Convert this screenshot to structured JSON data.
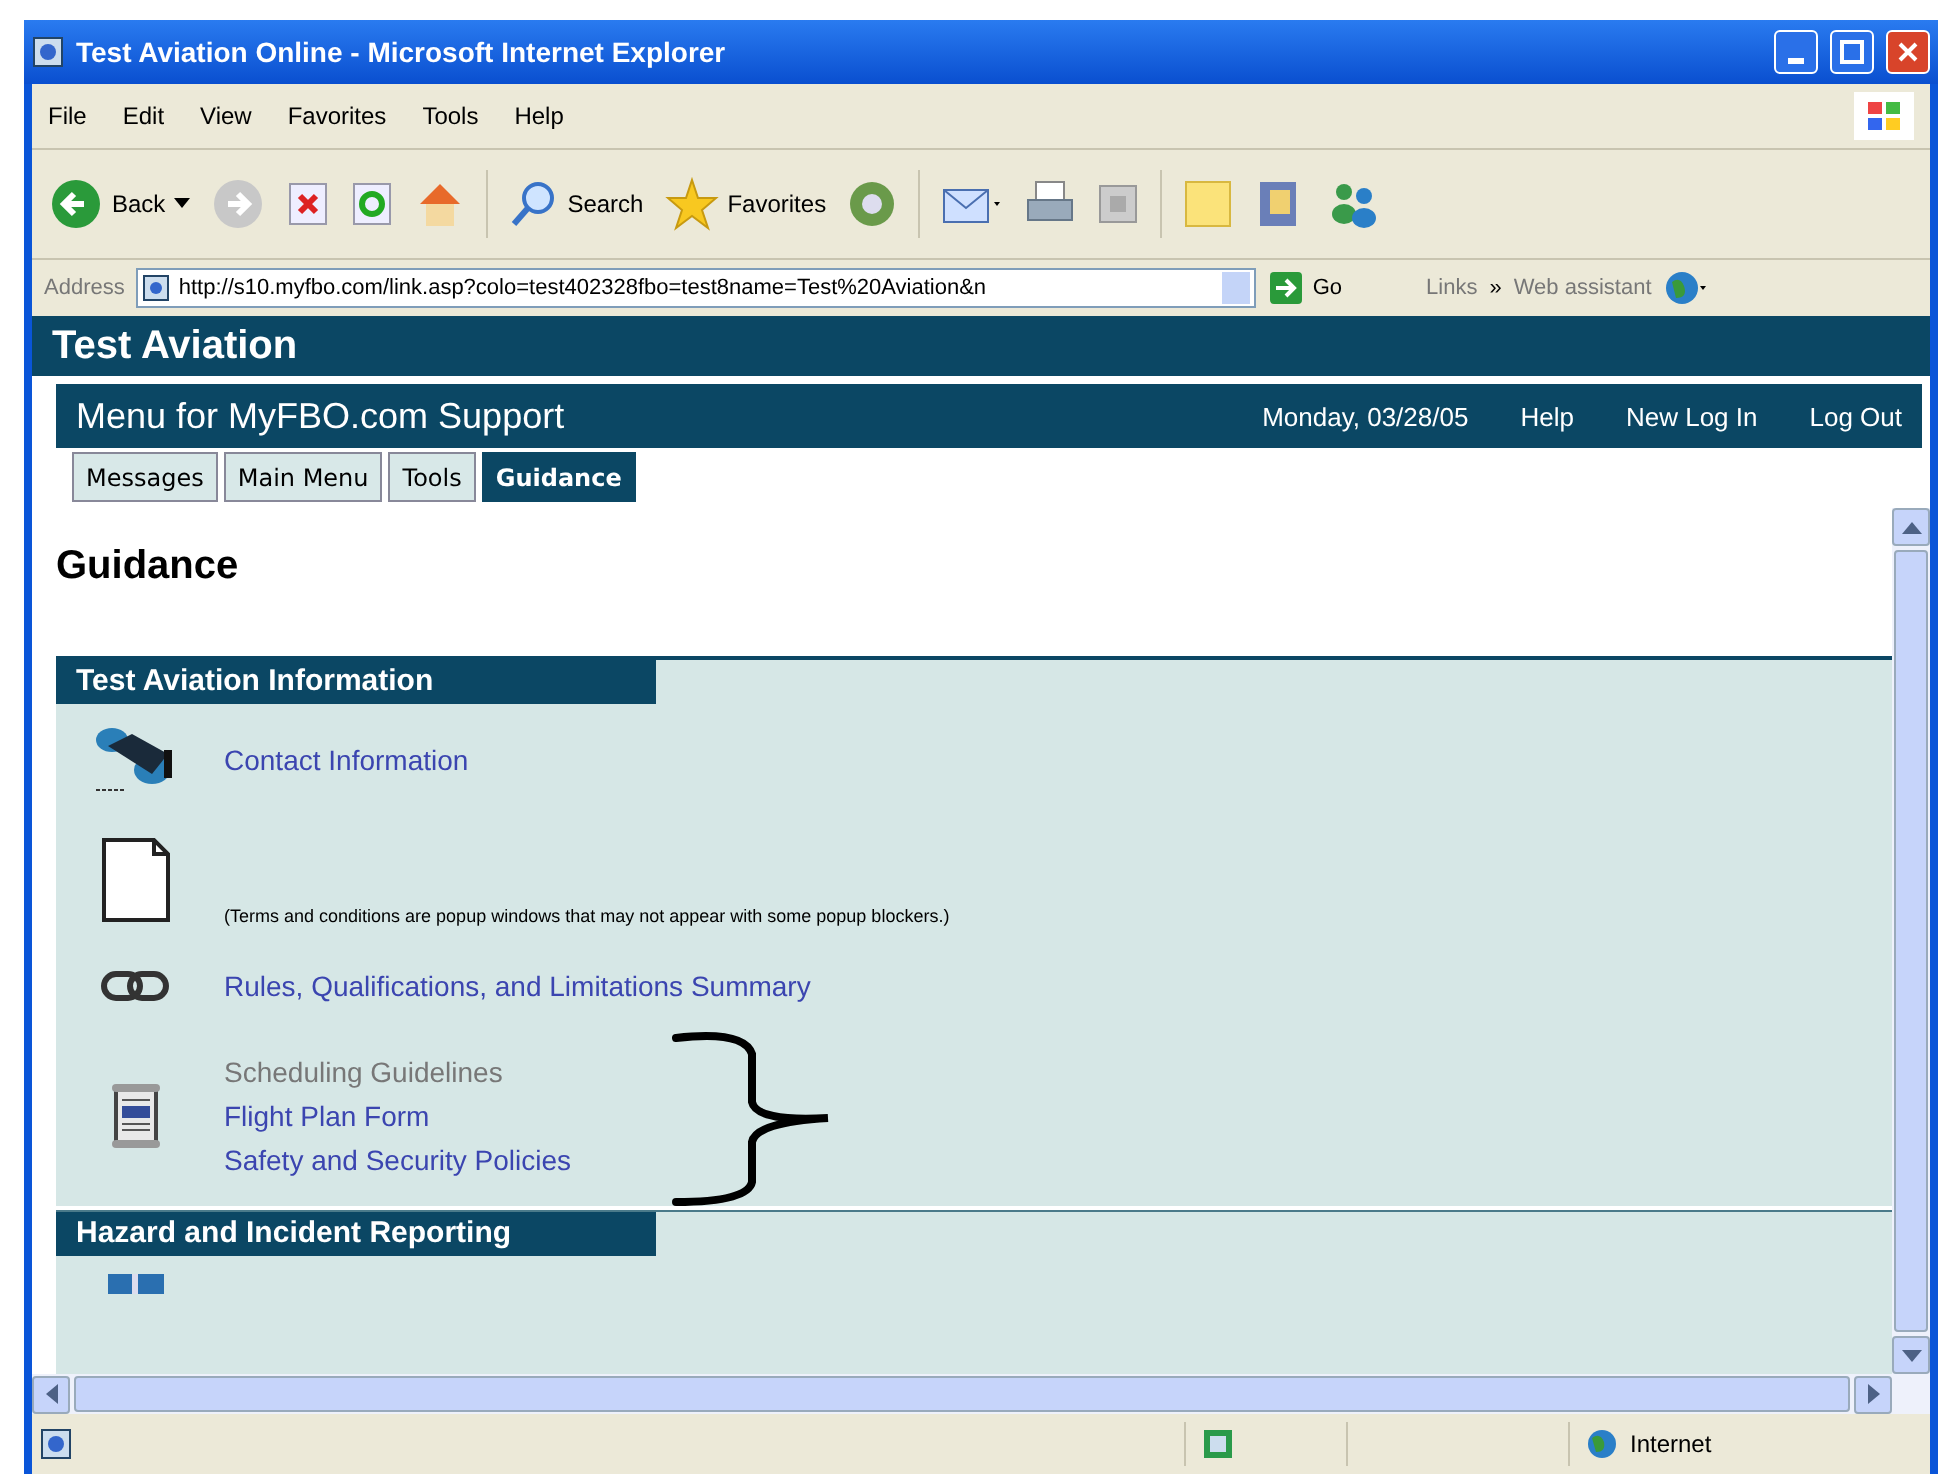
{
  "window": {
    "title": "Test Aviation Online - Microsoft Internet Explorer"
  },
  "menu": [
    "File",
    "Edit",
    "View",
    "Favorites",
    "Tools",
    "Help"
  ],
  "toolbar": {
    "back": "Back",
    "search": "Search",
    "favorites": "Favorites"
  },
  "address_bar": {
    "label": "Address",
    "url": "http://s10.myfbo.com/link.asp?colo=test402328fbo=test8name=Test%20Aviation&n",
    "go": "Go",
    "links": "Links",
    "links_more": "»",
    "web_assistant": "Web assistant"
  },
  "site": {
    "title": "Test Aviation",
    "menu_title": "Menu for MyFBO.com Support",
    "date": "Monday, 03/28/05",
    "links": [
      "Help",
      "New Log In",
      "Log Out"
    ]
  },
  "tabs": [
    {
      "label": "Messages",
      "selected": false
    },
    {
      "label": "Main Menu",
      "selected": false
    },
    {
      "label": "Tools",
      "selected": false
    },
    {
      "label": "Guidance",
      "selected": true
    }
  ],
  "page": {
    "heading": "Guidance",
    "sections": [
      {
        "title": "Test Aviation Information",
        "groups": [
          {
            "links": [
              {
                "label": "Contact Information",
                "visited": false
              }
            ]
          },
          {
            "note": "(Terms and conditions are popup windows that may not appear with some popup blockers.)"
          },
          {
            "links": [
              {
                "label": "Rules, Qualifications, and Limitations Summary",
                "visited": false
              }
            ]
          },
          {
            "links": [
              {
                "label": "Scheduling Guidelines",
                "visited": true
              },
              {
                "label": "Flight Plan Form",
                "visited": false
              },
              {
                "label": "Safety and Security Policies",
                "visited": false
              }
            ]
          }
        ]
      },
      {
        "title": "Hazard and Incident Reporting"
      }
    ]
  },
  "status_bar": {
    "zone": "Internet"
  }
}
